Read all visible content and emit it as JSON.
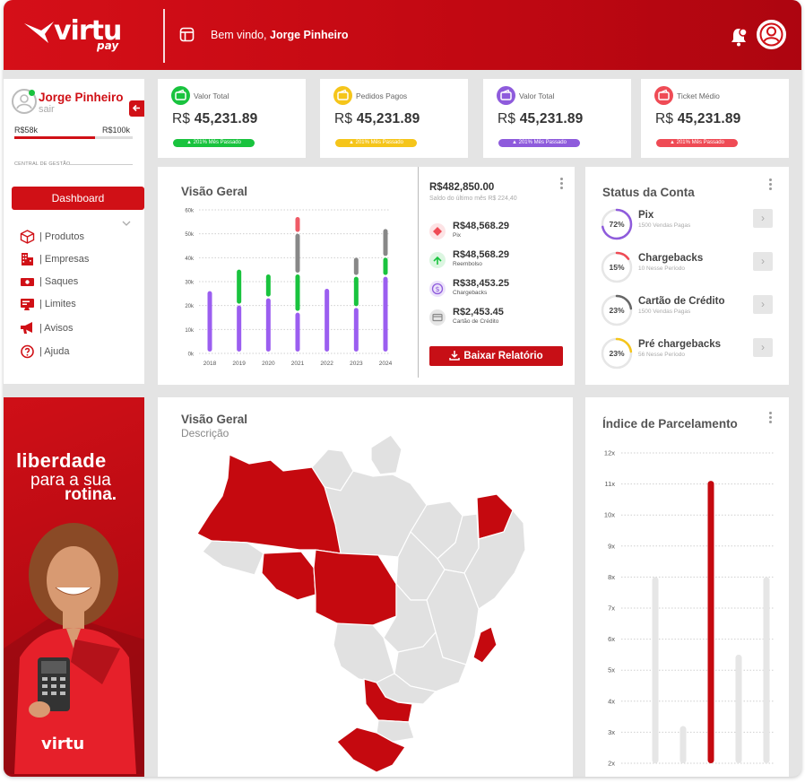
{
  "header": {
    "logo_text": "virtu",
    "logo_sub": "pay",
    "welcome_prefix": "Bem vindo,",
    "welcome_name": "Jorge Pinheiro"
  },
  "sidebar": {
    "user_name": "Jorge Pinheiro",
    "logout_label": "sair",
    "limit_min": "R$58k",
    "limit_max": "R$100k",
    "limit_progress": 0.68,
    "section_label": "CENTRAL DE GESTÃO",
    "dashboard_label": "Dashboard",
    "items": [
      {
        "label": "| Produtos",
        "icon": "box-icon"
      },
      {
        "label": "| Empresas",
        "icon": "building-icon"
      },
      {
        "label": "| Saques",
        "icon": "cash-icon"
      },
      {
        "label": "| Limites",
        "icon": "limits-icon"
      },
      {
        "label": "| Avisos",
        "icon": "megaphone-icon"
      },
      {
        "label": "| Ajuda",
        "icon": "help-icon"
      }
    ]
  },
  "stats": [
    {
      "title": "Valor Total",
      "currency": "R$",
      "value": "45,231.89",
      "badge": "▲ 201% Mês Passado",
      "color": "#19c33e"
    },
    {
      "title": "Pedidos Pagos",
      "currency": "R$",
      "value": "45,231.89",
      "badge": "▲ 201% Mês Passado",
      "color": "#f5c51a"
    },
    {
      "title": "Valor Total",
      "currency": "R$",
      "value": "45,231.89",
      "badge": "▲ 201% Mês Passado",
      "color": "#8e5bdc"
    },
    {
      "title": "Ticket Médio",
      "currency": "R$",
      "value": "45,231.89",
      "badge": "▲ 201% Mês Passado",
      "color": "#ef4b55"
    }
  ],
  "overview": {
    "title": "Visão Geral",
    "balance": "R$482,850.00",
    "balance_sub": "Saldo do último mês R$ 224,40",
    "transactions": [
      {
        "value": "R$48,568.29",
        "label": "Pix",
        "color": "#ef4b55"
      },
      {
        "value": "R$48,568.29",
        "label": "Reembolso",
        "color": "#19c33e"
      },
      {
        "value": "R$38,453.25",
        "label": "Chargebacks",
        "color": "#8e5bdc"
      },
      {
        "value": "R$2,453.45",
        "label": "Cartão de Crédito",
        "color": "#888888"
      }
    ],
    "download_label": "Baixar Relatório"
  },
  "account_status": {
    "title": "Status da Conta",
    "items": [
      {
        "percent": "72%",
        "name": "Pix",
        "sub": "1500 Vendas Pagas",
        "value": 72,
        "color": "#8e5bdc"
      },
      {
        "percent": "15%",
        "name": "Chargebacks",
        "sub": "10 Nesse Período",
        "value": 15,
        "color": "#ef4b55"
      },
      {
        "percent": "23%",
        "name": "Cartão de Crédito",
        "sub": "1500 Vendas Pagas",
        "value": 23,
        "color": "#666666"
      },
      {
        "percent": "23%",
        "name": "Pré chargebacks",
        "sub": "56 Nesse Período",
        "value": 23,
        "color": "#f5c51a"
      }
    ]
  },
  "promo": {
    "line1": "liberdade",
    "line2": "para a sua",
    "line3": "rotina.",
    "logo": "virtu"
  },
  "map": {
    "title": "Visão Geral",
    "subtitle": "Descrição"
  },
  "chart_data": [
    {
      "type": "bar",
      "title": "Visão Geral",
      "categories": [
        "2018",
        "2019",
        "2020",
        "2021",
        "2022",
        "2023",
        "2024"
      ],
      "y_ticks": [
        "0k",
        "10k",
        "20k",
        "30k",
        "40k",
        "50k",
        "60k"
      ],
      "ylim": [
        0,
        60
      ],
      "series": [
        {
          "color": "#9b5ef0",
          "values": [
            26,
            20,
            23,
            17,
            27,
            19,
            32
          ]
        },
        {
          "color": "#19c33e",
          "values": [
            0,
            35,
            33,
            33,
            0,
            32,
            40
          ]
        },
        {
          "color": "#888888",
          "values": [
            0,
            0,
            0,
            50,
            0,
            40,
            52
          ]
        },
        {
          "color": "#ef5b67",
          "values": [
            0,
            0,
            0,
            57,
            0,
            0,
            0
          ]
        }
      ],
      "grid": true,
      "legend": "none"
    },
    {
      "type": "bar",
      "title": "Índice de Parcelamento",
      "y_ticks": [
        "2x",
        "3x",
        "4x",
        "5x",
        "6x",
        "7x",
        "8x",
        "9x",
        "10x",
        "11x",
        "12x"
      ],
      "ylim": [
        2,
        12
      ],
      "values": [
        8,
        3.2,
        11.1,
        5.5,
        8
      ],
      "highlight_index": 2,
      "grid": true
    }
  ]
}
